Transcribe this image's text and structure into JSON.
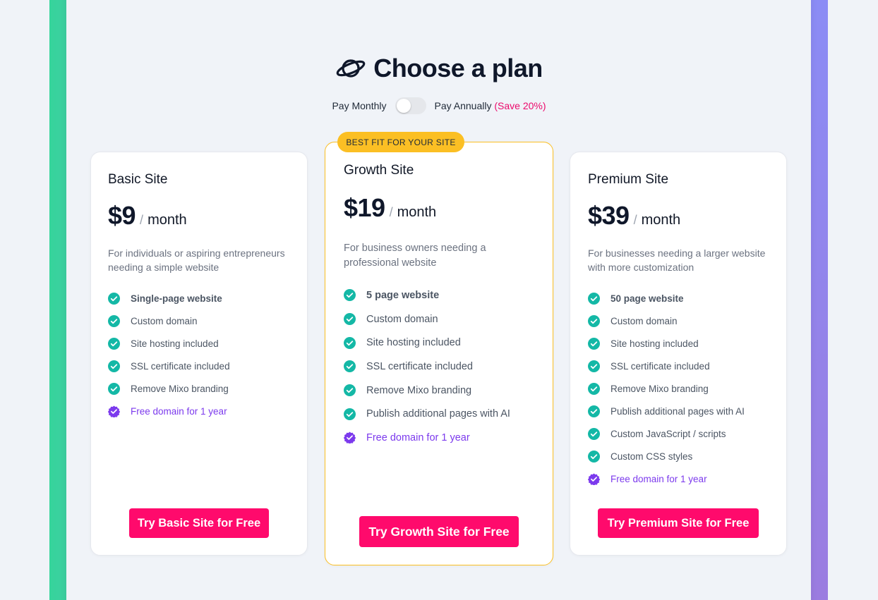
{
  "header": {
    "title": "Choose a plan",
    "icon": "planet-icon"
  },
  "billing": {
    "monthly_label": "Pay Monthly",
    "annual_label": "Pay Annually",
    "save_label": "(Save 20%)",
    "annual_selected": false
  },
  "badge": "BEST FIT FOR YOUR SITE",
  "colors": {
    "accent": "#ff0a6c",
    "check": "#14b8a6",
    "bonus": "#7c3aed",
    "badge": "#fbbf24"
  },
  "plans": [
    {
      "name": "Basic Site",
      "price": "$9",
      "slash": "/",
      "period": "month",
      "description_l1": "For individuals or aspiring entrepreneurs",
      "description_l2": "needing a simple website",
      "features": [
        "Single-page website",
        "Custom domain",
        "Site hosting included",
        "SSL certificate included",
        "Remove Mixo branding"
      ],
      "bonus": "Free domain for 1 year",
      "cta": "Try Basic Site for Free"
    },
    {
      "name": "Growth Site",
      "price": "$19",
      "slash": "/",
      "period": "month",
      "description_l1": "For business owners needing a",
      "description_l2": "professional website",
      "features": [
        "5 page website",
        "Custom domain",
        "Site hosting included",
        "SSL certificate included",
        "Remove Mixo branding",
        "Publish additional pages with AI"
      ],
      "bonus": "Free domain for 1 year",
      "cta": "Try Growth Site for Free"
    },
    {
      "name": "Premium Site",
      "price": "$39",
      "slash": "/",
      "period": "month",
      "description_l1": "For businesses needing a larger website",
      "description_l2": "with more customization",
      "features": [
        "50 page website",
        "Custom domain",
        "Site hosting included",
        "SSL certificate included",
        "Remove Mixo branding",
        "Publish additional pages with AI",
        "Custom JavaScript / scripts",
        "Custom CSS styles"
      ],
      "bonus": "Free domain for 1 year",
      "cta": "Try Premium Site for Free"
    }
  ]
}
